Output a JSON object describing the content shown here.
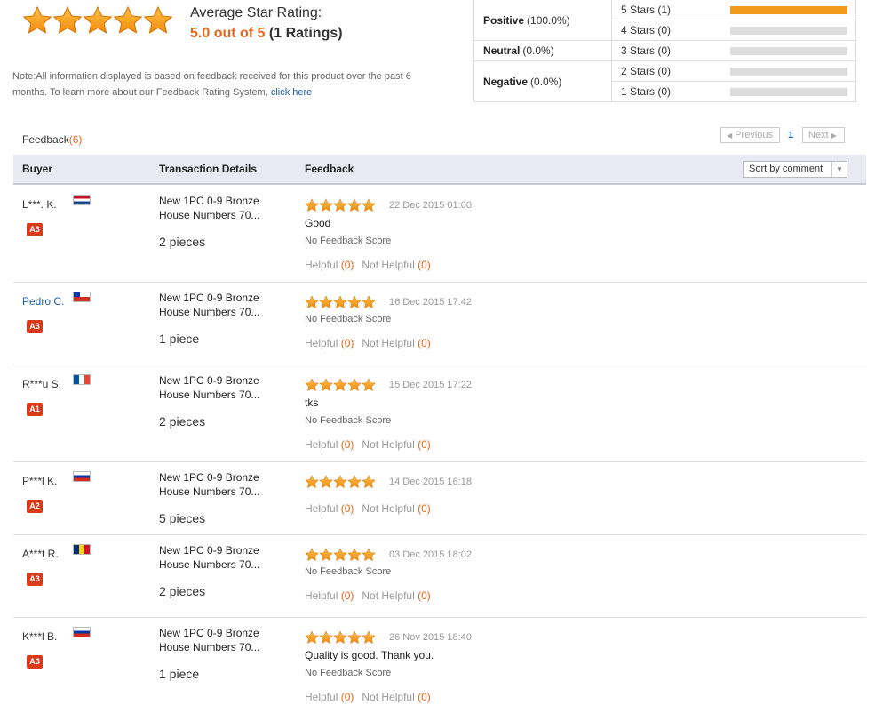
{
  "summary": {
    "title": "Average Star Rating:",
    "score_text": "5.0 out of 5",
    "count_text": "(1 Ratings)",
    "note": "Note:All information displayed is based on feedback received for this product over the past 6 months. To learn more about our Feedback Rating System, ",
    "note_link": "click here"
  },
  "breakdown": {
    "categories": [
      {
        "label": "Positive",
        "pct": "(100.0%)"
      },
      {
        "label": "Neutral",
        "pct": "(0.0%)"
      },
      {
        "label": "Negative",
        "pct": "(0.0%)"
      }
    ],
    "stars": [
      {
        "label": "5 Stars (1)",
        "fraction": 1.0
      },
      {
        "label": "4 Stars (0)",
        "fraction": 0
      },
      {
        "label": "3 Stars (0)",
        "fraction": 0
      },
      {
        "label": "2 Stars (0)",
        "fraction": 0
      },
      {
        "label": "1 Stars (0)",
        "fraction": 0
      }
    ]
  },
  "feedback_header": {
    "label": "Feedback",
    "count": "(6)"
  },
  "pager": {
    "prev": "Previous",
    "page": "1",
    "next": "Next"
  },
  "table": {
    "col_buyer": "Buyer",
    "col_transaction": "Transaction Details",
    "col_feedback": "Feedback",
    "sort_label": "Sort by comment"
  },
  "colors": {
    "accent": "#e4661a",
    "bar_fill": "#f19b1c",
    "link": "#1b5fad",
    "badge": "#d93a1a"
  },
  "rows": [
    {
      "buyer": "L***. K.",
      "flag": "netherlands-flag",
      "badge": "A3",
      "product": "New 1PC 0-9 Bronze House Numbers 70...",
      "pieces": "2 pieces",
      "stars": 5,
      "date": "22 Dec 2015 01:00",
      "comment": "Good",
      "score": "No Feedback Score",
      "helpful": "Helpful",
      "helpful_count": "(0)",
      "not_helpful": "Not Helpful",
      "not_helpful_count": "(0)"
    },
    {
      "buyer": "Pedro C.",
      "flag": "chile-flag",
      "badge": "A3",
      "product": "New 1PC 0-9 Bronze House Numbers 70...",
      "pieces": "1 piece",
      "stars": 5,
      "date": "16 Dec 2015 17:42",
      "comment": "",
      "score": "No Feedback Score",
      "helpful": "Helpful",
      "helpful_count": "(0)",
      "not_helpful": "Not Helpful",
      "not_helpful_count": "(0)"
    },
    {
      "buyer": "R***u S.",
      "flag": "france-flag",
      "badge": "A1",
      "product": "New 1PC 0-9 Bronze House Numbers 70...",
      "pieces": "2 pieces",
      "stars": 5,
      "date": "15 Dec 2015 17:22",
      "comment": "tks",
      "score": "No Feedback Score",
      "helpful": "Helpful",
      "helpful_count": "(0)",
      "not_helpful": "Not Helpful",
      "not_helpful_count": "(0)"
    },
    {
      "buyer": "P***l K.",
      "flag": "russia-flag",
      "badge": "A2",
      "product": "New 1PC 0-9 Bronze House Numbers 70...",
      "pieces": "5 pieces",
      "stars": 5,
      "date": "14 Dec 2015 16:18",
      "comment": "",
      "score": "",
      "helpful": "Helpful",
      "helpful_count": "(0)",
      "not_helpful": "Not Helpful",
      "not_helpful_count": "(0)"
    },
    {
      "buyer": "A***t R.",
      "flag": "romania-flag",
      "badge": "A3",
      "product": "New 1PC 0-9 Bronze House Numbers 70...",
      "pieces": "2 pieces",
      "stars": 5,
      "date": "03 Dec 2015 18:02",
      "comment": "",
      "score": "No Feedback Score",
      "helpful": "Helpful",
      "helpful_count": "(0)",
      "not_helpful": "Not Helpful",
      "not_helpful_count": "(0)"
    },
    {
      "buyer": "K***l B.",
      "flag": "russia-flag",
      "badge": "A3",
      "product": "New 1PC 0-9 Bronze House Numbers 70...",
      "pieces": "1 piece",
      "stars": 5,
      "date": "26 Nov 2015 18:40",
      "comment": "Quality is good. Thank you.",
      "score": "No Feedback Score",
      "helpful": "Helpful",
      "helpful_count": "(0)",
      "not_helpful": "Not Helpful",
      "not_helpful_count": "(0)"
    }
  ]
}
